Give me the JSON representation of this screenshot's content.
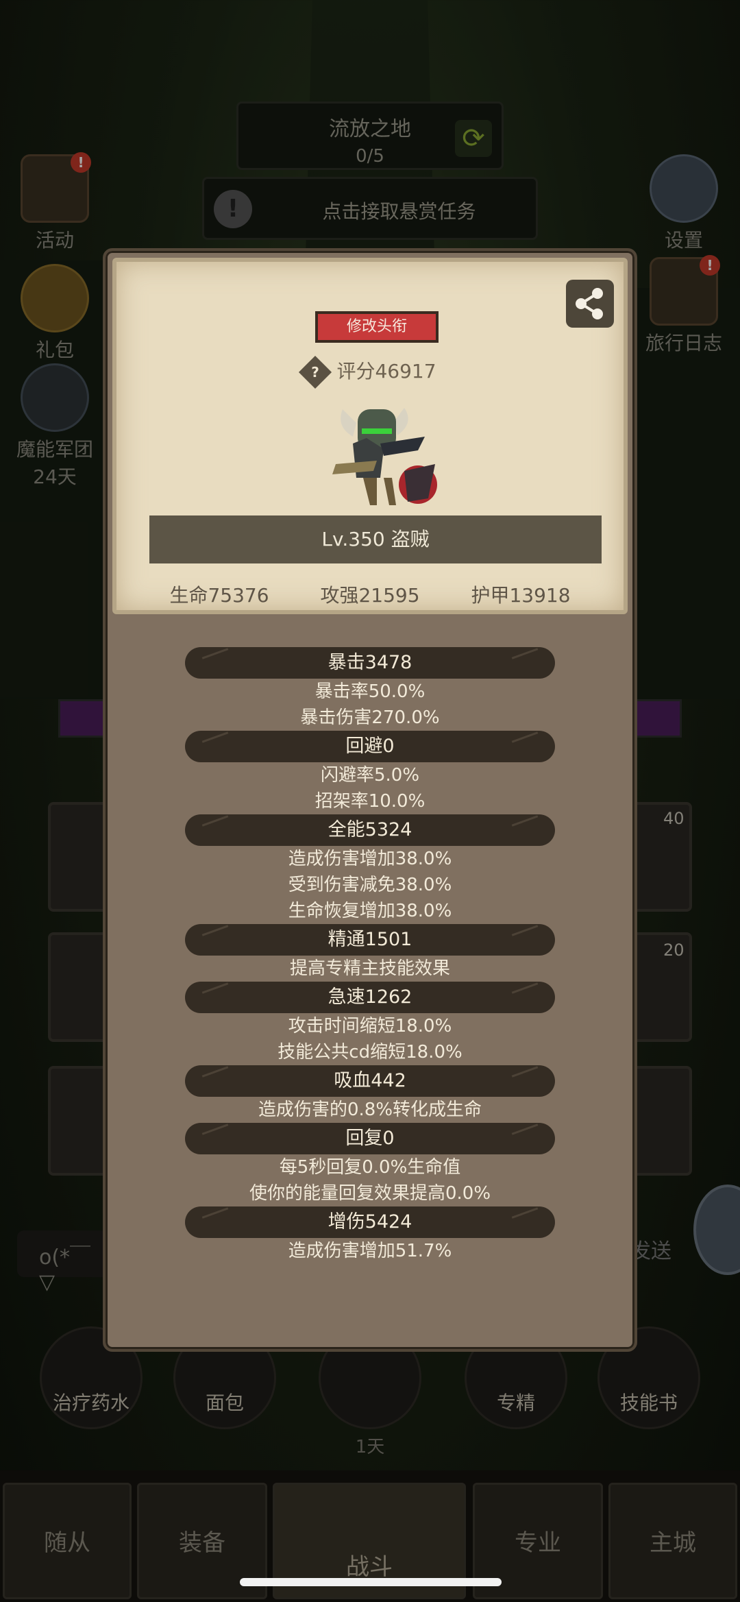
{
  "background": {
    "map": {
      "name": "流放之地",
      "progress": "0/5"
    },
    "bounty": {
      "label": "点击接取悬赏任务"
    },
    "left_buttons": [
      {
        "label": "活动"
      },
      {
        "label": "礼包"
      },
      {
        "label": "魔能军团",
        "sub": "24天"
      }
    ],
    "right_buttons": [
      {
        "label": "设置"
      },
      {
        "label": "旅行日志"
      }
    ],
    "slot_numbers": [
      "40",
      "20"
    ],
    "chat": {
      "input": "o(*￣▽",
      "send": "发送"
    },
    "items": [
      {
        "label": "治疗药水"
      },
      {
        "label": "面包"
      },
      {
        "label": "1天"
      },
      {
        "label": "专精"
      },
      {
        "label": "技能书"
      }
    ],
    "nav": [
      {
        "label": "随从"
      },
      {
        "label": "装备"
      },
      {
        "label": "战斗"
      },
      {
        "label": "专业"
      },
      {
        "label": "主城"
      }
    ]
  },
  "profile": {
    "title_button": "修改头衔",
    "score": "评分46917",
    "level_class": "Lv.350 盗贼",
    "stats": {
      "hp": "生命75376",
      "atk": "攻强21595",
      "armor": "护甲13918"
    }
  },
  "stats_list": [
    {
      "header": "暴击3478",
      "details": [
        "暴击率50.0%",
        "暴击伤害270.0%"
      ]
    },
    {
      "header": "回避0",
      "details": [
        "闪避率5.0%",
        "招架率10.0%"
      ]
    },
    {
      "header": "全能5324",
      "details": [
        "造成伤害增加38.0%",
        "受到伤害减免38.0%",
        "生命恢复增加38.0%"
      ]
    },
    {
      "header": "精通1501",
      "details": [
        "提高专精主技能效果"
      ]
    },
    {
      "header": "急速1262",
      "details": [
        "攻击时间缩短18.0%",
        "技能公共cd缩短18.0%"
      ]
    },
    {
      "header": "吸血442",
      "details": [
        "造成伤害的0.8%转化成生命"
      ]
    },
    {
      "header": "回复0",
      "details": [
        "每5秒回复0.0%生命值",
        "使你的能量回复效果提高0.0%"
      ]
    },
    {
      "header": "增伤5424",
      "details": [
        "造成伤害增加51.7%"
      ]
    }
  ]
}
